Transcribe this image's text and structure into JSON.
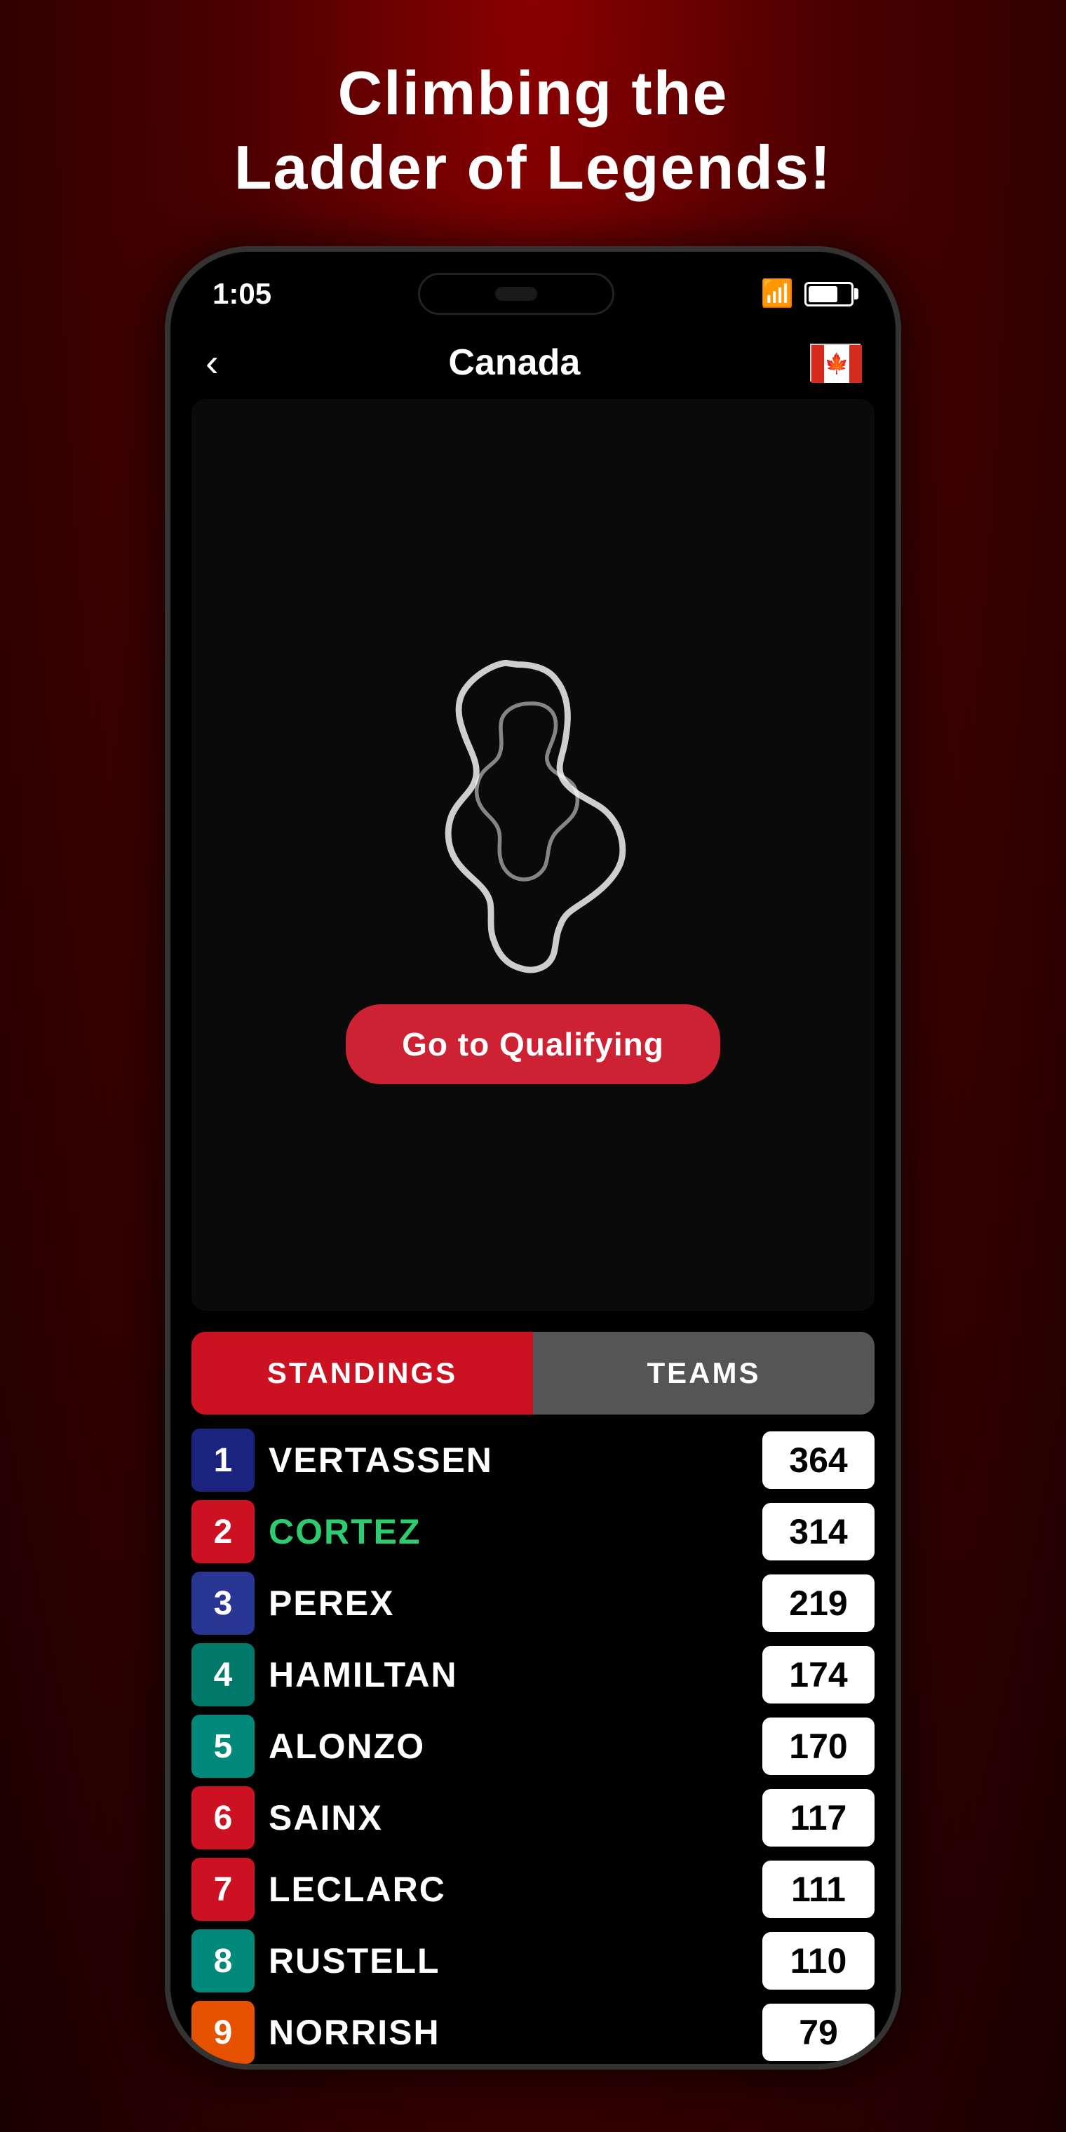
{
  "page": {
    "title_line1": "Climbing the",
    "title_line2": "Ladder of Legends!"
  },
  "phone": {
    "time": "1:05",
    "nav": {
      "back_label": "‹",
      "title": "Canada",
      "flag_alt": "Canada flag"
    },
    "track": {
      "button_label": "Go to Qualifying"
    },
    "tabs": {
      "standings_label": "STANDINGS",
      "teams_label": "TEAMS"
    },
    "standings": [
      {
        "position": "1",
        "name": "VERTASSEN",
        "points": "364",
        "highlighted": false,
        "color_class": "pos-dark-blue"
      },
      {
        "position": "2",
        "name": "CORTEZ",
        "points": "314",
        "highlighted": true,
        "color_class": "pos-red"
      },
      {
        "position": "3",
        "name": "PEREX",
        "points": "219",
        "highlighted": false,
        "color_class": "pos-dark-blue2"
      },
      {
        "position": "4",
        "name": "HAMILTAN",
        "points": "174",
        "highlighted": false,
        "color_class": "pos-teal"
      },
      {
        "position": "5",
        "name": "ALONZO",
        "points": "170",
        "highlighted": false,
        "color_class": "pos-teal2"
      },
      {
        "position": "6",
        "name": "SAINX",
        "points": "117",
        "highlighted": false,
        "color_class": "pos-red2"
      },
      {
        "position": "7",
        "name": "LECLARC",
        "points": "111",
        "highlighted": false,
        "color_class": "pos-red3"
      },
      {
        "position": "8",
        "name": "RUSTELL",
        "points": "110",
        "highlighted": false,
        "color_class": "pos-teal3"
      },
      {
        "position": "9",
        "name": "NORRISH",
        "points": "79",
        "highlighted": false,
        "color_class": "pos-orange"
      }
    ]
  }
}
